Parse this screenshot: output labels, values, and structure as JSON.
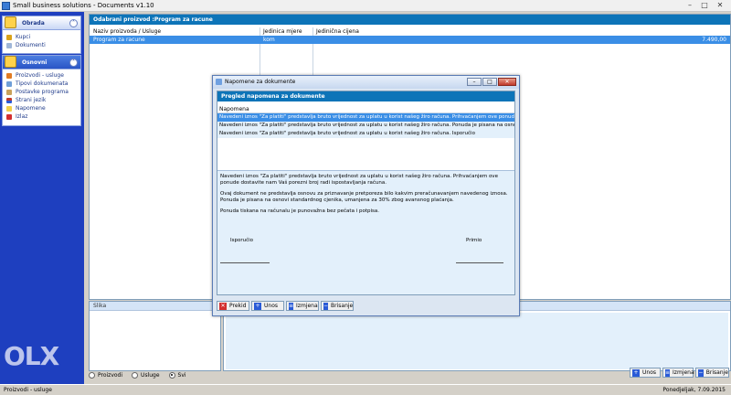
{
  "window": {
    "title": "Small business solutions - Documents v1.10"
  },
  "sidebar": {
    "groups": [
      {
        "label": "Obrada",
        "items": [
          "Kupci",
          "Dokumenti"
        ]
      },
      {
        "label": "Osnovni",
        "items": [
          "Proizvodi - usluge",
          "Tipovi dokumenata",
          "Postavke programa",
          "Strani jezik",
          "Napomene",
          "Izlaz"
        ]
      }
    ]
  },
  "main": {
    "panel_header": "Odabrani proizvod :Program za racune",
    "columns": [
      "Naziv proizvoda / Usluge",
      "Jedinica mjere",
      "Jedinična cijena"
    ],
    "row": {
      "name": "Program za racune",
      "unit": "kom",
      "price": "7.490,00"
    },
    "slika_label": "Slika",
    "radios": [
      {
        "label": "Proizvodi",
        "checked": false
      },
      {
        "label": "Usluge",
        "checked": false
      },
      {
        "label": "Svi",
        "checked": true
      }
    ],
    "buttons": {
      "unos": "Unos",
      "izmjena": "Izmjena",
      "brisanje": "Brisanje"
    }
  },
  "dialog": {
    "title": "Napomene za dokumente",
    "panel_header": "Pregled napomena za dokumente",
    "column": "Napomena",
    "rows": [
      "Navedeni iznos \"Za platiti\" predstavlja bruto vrijednost za uplatu u korist našeg žiro računa. Prihvaćanjem ove ponude dostavite nam",
      "Navedeni iznos \"Za platiti\" predstavlja bruto vrijednost za uplatu u korist našeg žiro računa. Ponuda je pisana na osnovi standardnog c",
      "Navedeni iznos \"Za platiti\" predstavlja bruto vrijednost za uplatu u korist našeg žiro računa.          Isporučio"
    ],
    "detail": {
      "p1": "Navedeni iznos \"Za platiti\" predstavlja bruto vrijednost za uplatu u korist našeg žiro računa. Prihvaćanjem ove ponude dostavite nam Vaš porezni broj radi ispostavljanja računa.",
      "p2": "Ovaj dokument ne predstavlja osnovu za priznavanje pretporeza bilo kakvim preračunavanjem navedenog iznosa. Ponuda je pisana na osnovi standardnog cjenika, umanjena za 30% zbog avansnog plaćanja.",
      "p3": "Ponuda tiskana na računalu je punovažna bez pečata i potpisa.",
      "sig_left": "Isporučio",
      "sig_right": "Primio"
    },
    "buttons": {
      "prekid": "Prekid",
      "unos": "Unos",
      "izmjena": "Izmjena",
      "brisanje": "Brisanje"
    }
  },
  "status": {
    "left": "Proizvodi - usluge",
    "right": "Ponedjeljak, 7.09.2015"
  },
  "watermark": "OLX"
}
